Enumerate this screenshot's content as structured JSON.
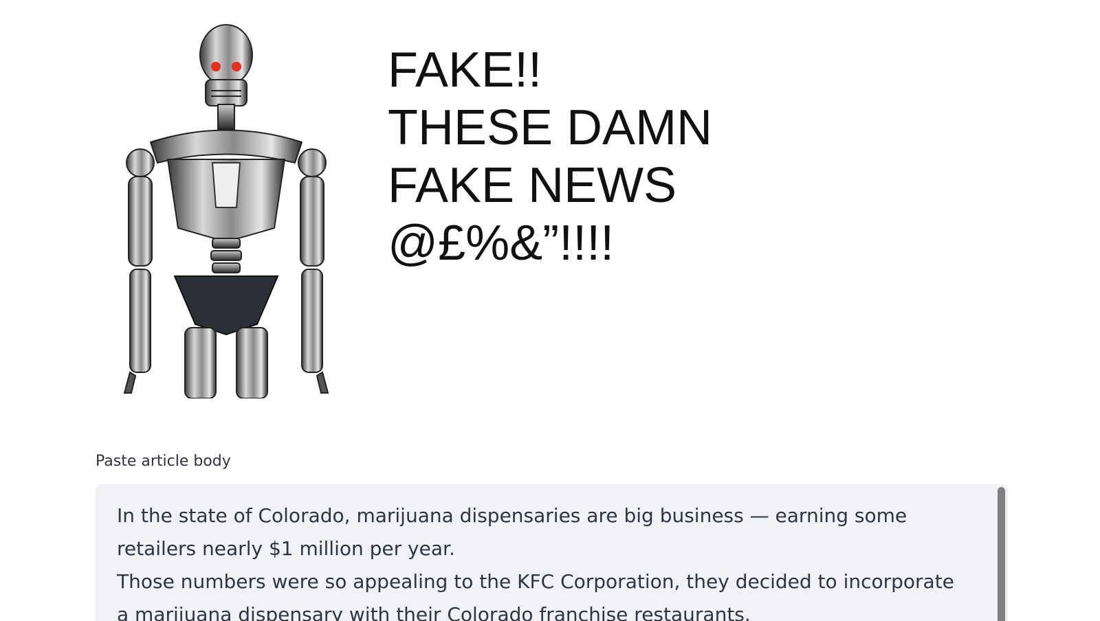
{
  "hero": {
    "caption_lines": [
      "FAKE!!",
      "THESE DAMN",
      "FAKE NEWS",
      "@£%&”!!!!"
    ],
    "image": "terminator-robot-illustration"
  },
  "article_input": {
    "label": "Paste article body",
    "paragraphs": [
      "In the state of Colorado, marijuana dispensaries are big business — earning some retailers nearly $1 million per year.",
      "Those numbers were so appealing to the KFC Corporation, they decided to incorporate a marijuana dispensary with their Colorado franchise restaurants."
    ]
  },
  "colors": {
    "textarea_bg": "#f0f2f6",
    "text": "#31333f",
    "robot_eyes": "#e53020"
  }
}
